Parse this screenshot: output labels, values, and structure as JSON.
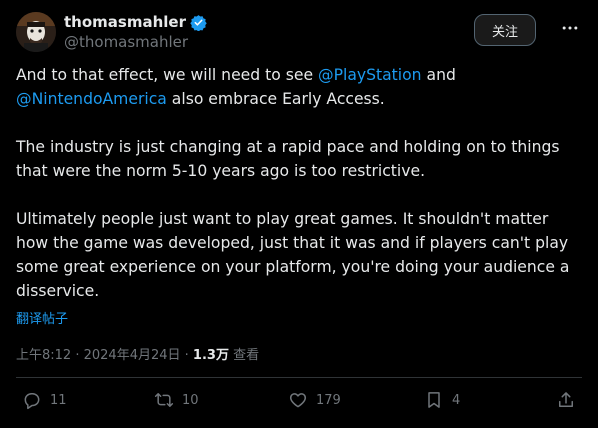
{
  "author": {
    "display_name": "thomasmahler",
    "handle": "@thomasmahler",
    "verified": true
  },
  "header": {
    "follow_label": "关注"
  },
  "tweet": {
    "p1_text_before": "And to that effect, we will need to see ",
    "mention_1": "@PlayStation",
    "p1_text_middle": " and",
    "mention_2": "@NintendoAmerica",
    "p1_text_after": " also embrace Early Access.",
    "p2": "The industry is just changing at a rapid pace and holding on to things that were the norm 5-10 years ago is too restrictive.",
    "p3": "Ultimately people just want to play great games. It shouldn't matter how the game was developed, just that it was and if players can't play some great experience on your platform, you're doing your audience a disservice."
  },
  "translate_label": "翻译帖子",
  "meta": {
    "time": "上午8:12",
    "separator": " · ",
    "date": "2024年4月24日",
    "views_count": "1.3万",
    "views_label": " 查看"
  },
  "actions": {
    "replies": "11",
    "reposts": "10",
    "likes": "179",
    "bookmarks": "4"
  },
  "colors": {
    "accent": "#1d9bf0",
    "muted": "#71767b",
    "text": "#e7e9ea",
    "background": "#000000"
  },
  "icons": [
    "verified-badge-icon",
    "more-icon",
    "reply-icon",
    "repost-icon",
    "like-icon",
    "bookmark-icon",
    "share-icon"
  ]
}
